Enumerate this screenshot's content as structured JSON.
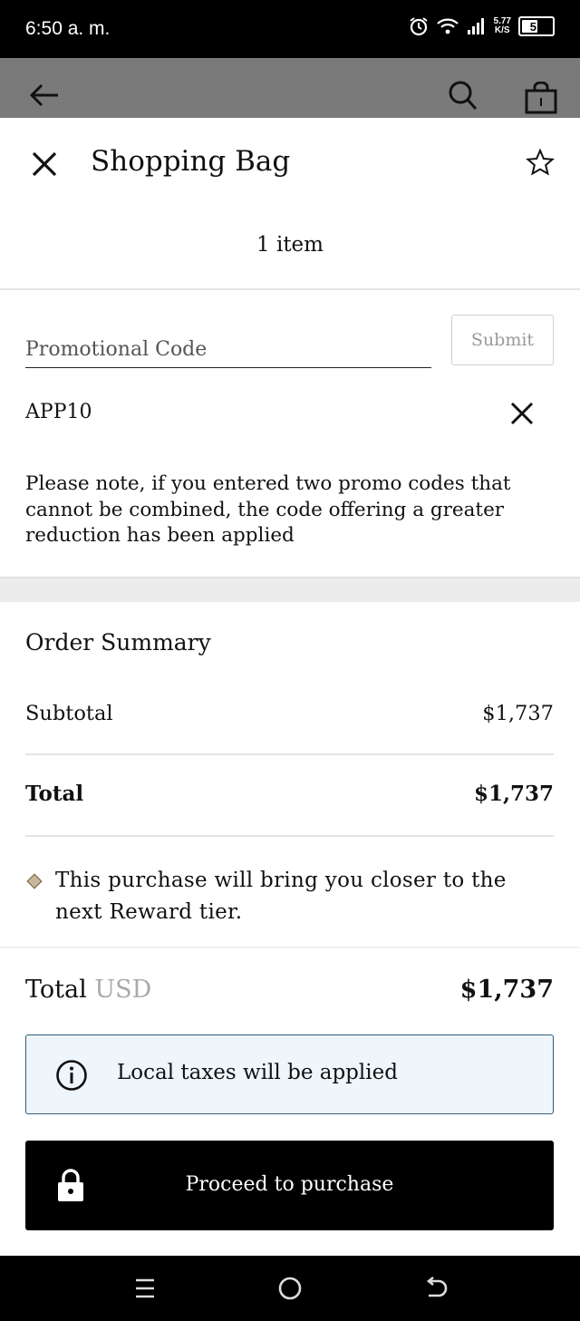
{
  "status_bar": {
    "time": "6:50 a. m.",
    "net_speed_value": "5.77",
    "net_speed_unit": "K/S",
    "battery": "51",
    "battery_level": 0.51,
    "icons": [
      "alarm-icon",
      "wifi-icon",
      "signal-icon",
      "battery-icon"
    ]
  },
  "app_header": {
    "icons": [
      "back-arrow-icon",
      "search-icon",
      "shopping-bag-icon"
    ]
  },
  "sheet": {
    "title": "Shopping Bag",
    "item_count": "1 item",
    "icons": [
      "close-icon",
      "star-icon"
    ]
  },
  "promo": {
    "placeholder": "Promotional Code",
    "value": "",
    "submit_label": "Submit",
    "applied_code": "APP10",
    "note": "Please note, if you entered two promo codes that cannot be combined, the code offering a greater reduction has been applied"
  },
  "order_summary": {
    "title": "Order Summary",
    "subtotal_label": "Subtotal",
    "subtotal_value": "$1,737",
    "total_label": "Total",
    "total_value": "$1,737",
    "reward_text": "This purchase will bring you closer to the next Reward tier."
  },
  "grand_total": {
    "label": "Total",
    "currency": "USD",
    "value": "$1,737"
  },
  "tax_notice": {
    "text": "Local taxes will be applied",
    "icon": "info-icon"
  },
  "purchase": {
    "label": "Proceed to purchase",
    "icon": "lock-icon"
  },
  "nav_bar": {
    "icons": [
      "menu-icon",
      "home-icon",
      "back-icon"
    ]
  },
  "colors": {
    "tax_box_bg": "#eef5fb",
    "tax_box_border": "#2f5f7a",
    "reward_diamond": "#c9b79c",
    "dim_overlay": "#7a7a7a"
  }
}
